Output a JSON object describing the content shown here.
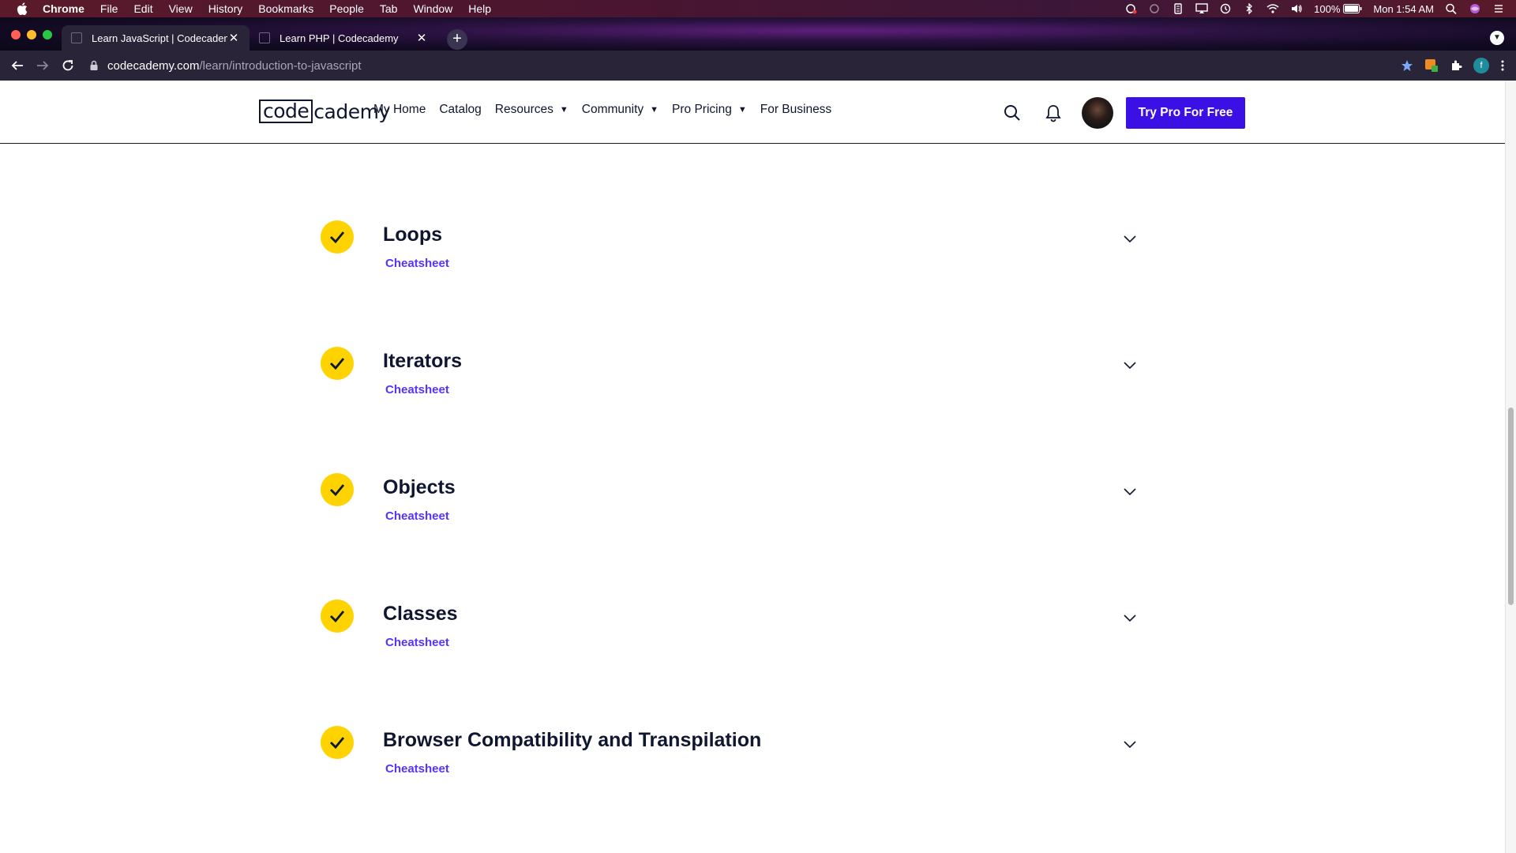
{
  "os_menubar": {
    "app": "Chrome",
    "items": [
      "File",
      "Edit",
      "View",
      "History",
      "Bookmarks",
      "People",
      "Tab",
      "Window",
      "Help"
    ],
    "battery": "100%",
    "clock": "Mon 1:54 AM"
  },
  "browser": {
    "tabs": [
      {
        "title": "Learn JavaScript | Codecademy",
        "active": true
      },
      {
        "title": "Learn PHP | Codecademy",
        "active": false
      }
    ],
    "url_host": "codecademy.com",
    "url_path": "/learn/introduction-to-javascript",
    "extension_avatar_letter": "f"
  },
  "site_nav": {
    "logo_boxed": "code",
    "logo_rest": "cademy",
    "links": [
      {
        "label": "My Home",
        "dropdown": false
      },
      {
        "label": "Catalog",
        "dropdown": false
      },
      {
        "label": "Resources",
        "dropdown": true
      },
      {
        "label": "Community",
        "dropdown": true
      },
      {
        "label": "Pro Pricing",
        "dropdown": true
      },
      {
        "label": "For Business",
        "dropdown": false
      }
    ],
    "cta_label": "Try Pro For Free"
  },
  "modules": [
    {
      "title": "Loops",
      "link": "Cheatsheet",
      "completed": true
    },
    {
      "title": "Iterators",
      "link": "Cheatsheet",
      "completed": true
    },
    {
      "title": "Objects",
      "link": "Cheatsheet",
      "completed": true
    },
    {
      "title": "Classes",
      "link": "Cheatsheet",
      "completed": true
    },
    {
      "title": "Browser Compatibility and Transpilation",
      "link": "Cheatsheet",
      "completed": true
    }
  ],
  "colors": {
    "check_badge": "#ffd300",
    "link": "#5533ff",
    "cta": "#3a10e5",
    "text": "#10162f"
  }
}
